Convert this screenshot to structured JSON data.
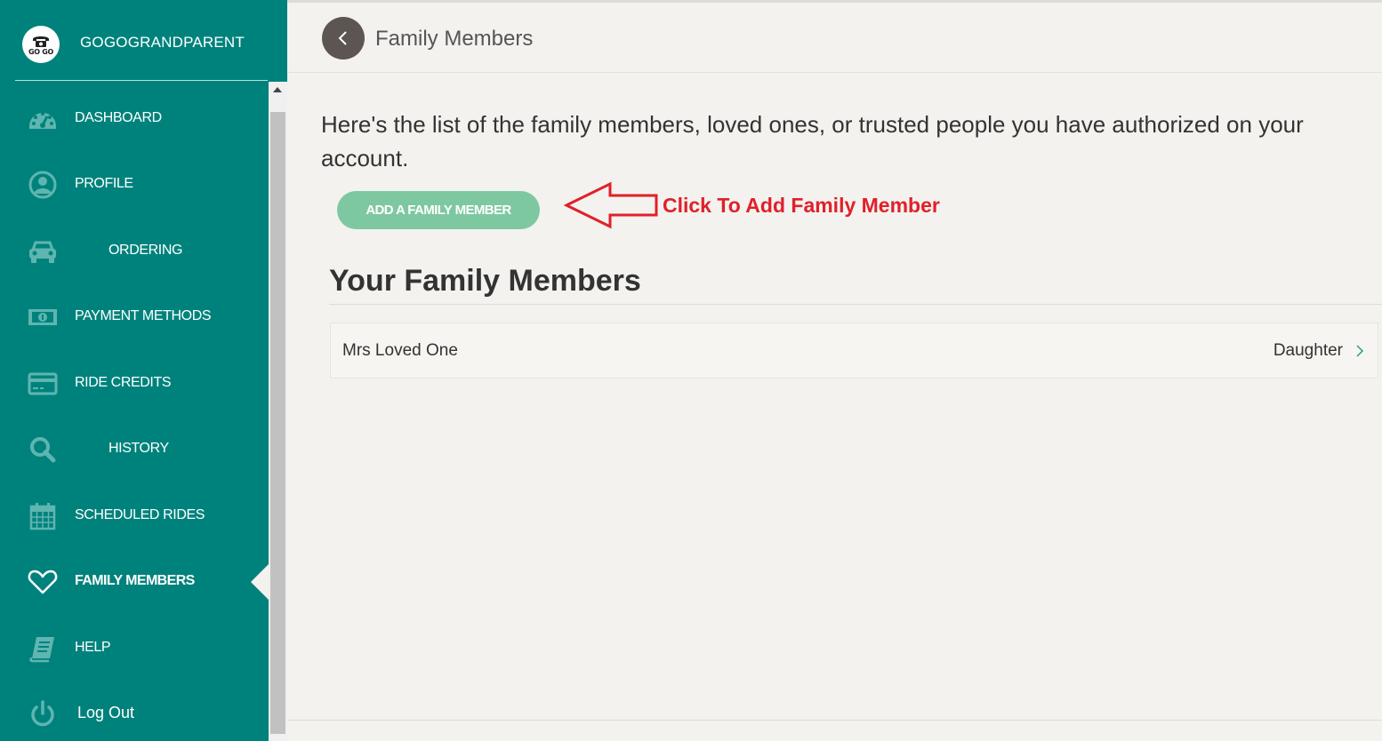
{
  "brand": {
    "name": "GOGOGRANDPARENT",
    "logo_text": "GO GO"
  },
  "sidebar": {
    "items": [
      {
        "label": "DASHBOARD",
        "icon": "dashboard-icon"
      },
      {
        "label": "PROFILE",
        "icon": "profile-icon"
      },
      {
        "label": "ORDERING",
        "icon": "car-icon"
      },
      {
        "label": "PAYMENT METHODS",
        "icon": "money-icon"
      },
      {
        "label": "RIDE CREDITS",
        "icon": "credit-card-icon"
      },
      {
        "label": "HISTORY",
        "icon": "search-icon"
      },
      {
        "label": "SCHEDULED RIDES",
        "icon": "calendar-icon"
      },
      {
        "label": "FAMILY MEMBERS",
        "icon": "heart-icon",
        "active": true
      },
      {
        "label": "HELP",
        "icon": "book-icon"
      },
      {
        "label": "Log Out",
        "icon": "power-icon"
      }
    ]
  },
  "header": {
    "title": "Family Members"
  },
  "main": {
    "intro": "Here's the list of the family members, loved ones, or trusted people you have authorized on your account.",
    "add_button_label": "ADD A FAMILY MEMBER",
    "annotation": "Click To Add Family Member",
    "section_title": "Your Family Members",
    "members": [
      {
        "name": "Mrs Loved One",
        "relation": "Daughter"
      }
    ]
  },
  "colors": {
    "sidebar_bg": "#00827c",
    "button_green": "#7ec8a1",
    "annotation_red": "#e0202a",
    "back_button": "#5d5551",
    "page_bg": "#f3f2ef"
  }
}
